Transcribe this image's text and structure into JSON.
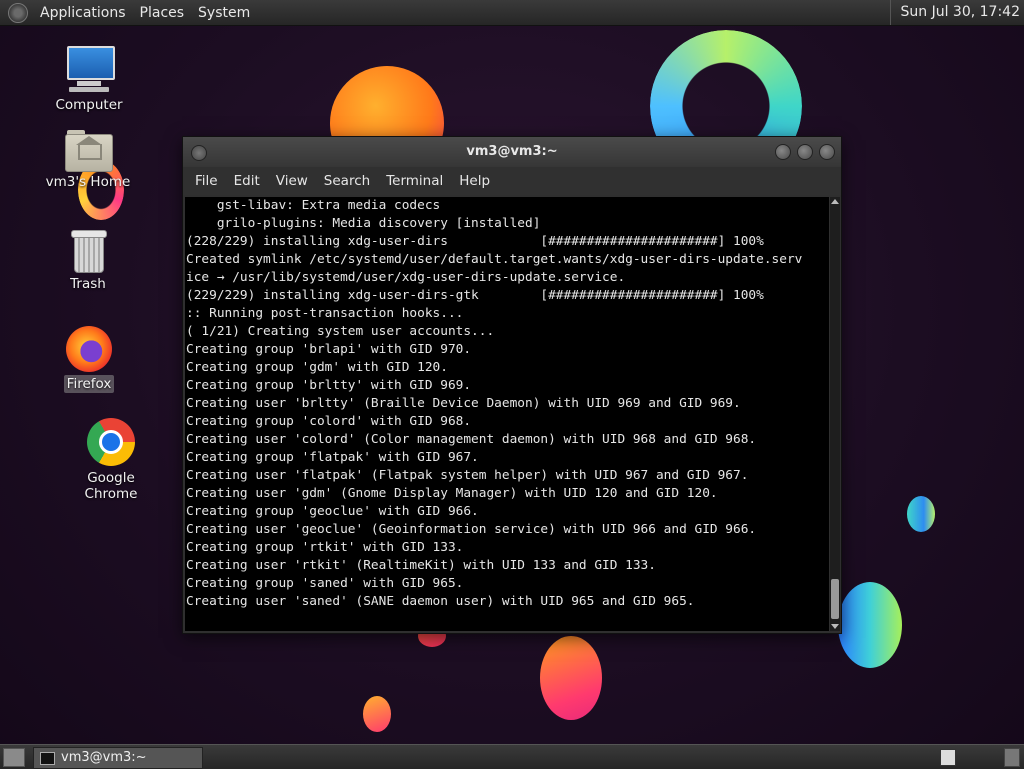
{
  "top_panel": {
    "menus": [
      "Applications",
      "Places",
      "System"
    ],
    "clock": "Sun Jul 30, 17:42"
  },
  "desktop": {
    "icons": [
      {
        "label": "Computer",
        "icon": "computer-icon"
      },
      {
        "label": "vm3's Home",
        "icon": "home-folder-icon"
      },
      {
        "label": "Trash",
        "icon": "trash-icon"
      },
      {
        "label": "Firefox",
        "icon": "firefox-icon"
      },
      {
        "label": "Google Chrome",
        "icon": "chrome-icon"
      }
    ]
  },
  "terminal": {
    "title": "vm3@vm3:~",
    "menu": [
      "File",
      "Edit",
      "View",
      "Search",
      "Terminal",
      "Help"
    ],
    "lines": [
      "    gst-libav: Extra media codecs",
      "    grilo-plugins: Media discovery [installed]",
      "(228/229) installing xdg-user-dirs            [######################] 100%",
      "Created symlink /etc/systemd/user/default.target.wants/xdg-user-dirs-update.serv",
      "ice → /usr/lib/systemd/user/xdg-user-dirs-update.service.",
      "(229/229) installing xdg-user-dirs-gtk        [######################] 100%",
      ":: Running post-transaction hooks...",
      "( 1/21) Creating system user accounts...",
      "Creating group 'brlapi' with GID 970.",
      "Creating group 'gdm' with GID 120.",
      "Creating group 'brltty' with GID 969.",
      "Creating user 'brltty' (Braille Device Daemon) with UID 969 and GID 969.",
      "Creating group 'colord' with GID 968.",
      "Creating user 'colord' (Color management daemon) with UID 968 and GID 968.",
      "Creating group 'flatpak' with GID 967.",
      "Creating user 'flatpak' (Flatpak system helper) with UID 967 and GID 967.",
      "Creating user 'gdm' (Gnome Display Manager) with UID 120 and GID 120.",
      "Creating group 'geoclue' with GID 966.",
      "Creating user 'geoclue' (Geoinformation service) with UID 966 and GID 966.",
      "Creating group 'rtkit' with GID 133.",
      "Creating user 'rtkit' (RealtimeKit) with UID 133 and GID 133.",
      "Creating group 'saned' with GID 965.",
      "Creating user 'saned' (SANE daemon user) with UID 965 and GID 965."
    ]
  },
  "bottom_panel": {
    "task_label": "vm3@vm3:~"
  }
}
